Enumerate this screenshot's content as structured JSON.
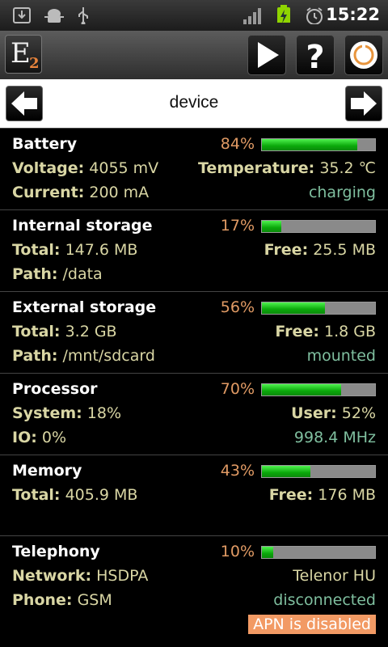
{
  "status_bar": {
    "time": "15:22",
    "icons": [
      "download-icon",
      "android-debug-icon",
      "usb-icon",
      "signal-icon",
      "battery-charging-icon",
      "alarm-icon"
    ]
  },
  "toolbar": {
    "logo_letter": "E",
    "logo_sub": "2",
    "buttons": [
      "play-icon",
      "help-icon",
      "power-icon"
    ]
  },
  "nav": {
    "title": "device"
  },
  "battery": {
    "title": "Battery",
    "percent_text": "84%",
    "percent": 84,
    "voltage_label": "Voltage:",
    "voltage_value": "4055 mV",
    "temperature_label": "Temperature:",
    "temperature_value": "35.2 ℃",
    "current_label": "Current:",
    "current_value": "200 mA",
    "status": "charging"
  },
  "internal_storage": {
    "title": "Internal storage",
    "percent_text": "17%",
    "percent": 17,
    "total_label": "Total:",
    "total_value": "147.6 MB",
    "free_label": "Free:",
    "free_value": "25.5 MB",
    "path_label": "Path:",
    "path_value": "/data"
  },
  "external_storage": {
    "title": "External storage",
    "percent_text": "56%",
    "percent": 56,
    "total_label": "Total:",
    "total_value": "3.2 GB",
    "free_label": "Free:",
    "free_value": "1.8 GB",
    "path_label": "Path:",
    "path_value": "/mnt/sdcard",
    "status": "mounted"
  },
  "processor": {
    "title": "Processor",
    "percent_text": "70%",
    "percent": 70,
    "system_label": "System:",
    "system_value": "18%",
    "user_label": "User:",
    "user_value": "52%",
    "io_label": "IO:",
    "io_value": "0%",
    "frequency": "998.4 MHz"
  },
  "memory": {
    "title": "Memory",
    "percent_text": "43%",
    "percent": 43,
    "total_label": "Total:",
    "total_value": "405.9 MB",
    "free_label": "Free:",
    "free_value": "176 MB"
  },
  "telephony": {
    "title": "Telephony",
    "percent_text": "10%",
    "percent": 10,
    "network_label": "Network:",
    "network_value": "HSDPA",
    "operator": "Telenor HU",
    "phone_label": "Phone:",
    "phone_value": "GSM",
    "status": "disconnected",
    "apn_status": "APN is disabled"
  },
  "colors": {
    "accent_orange": "#e09a64",
    "bar_green": "#0aa80a",
    "label_yellow": "#d9d6a4",
    "status_green": "#7fbf9f"
  }
}
